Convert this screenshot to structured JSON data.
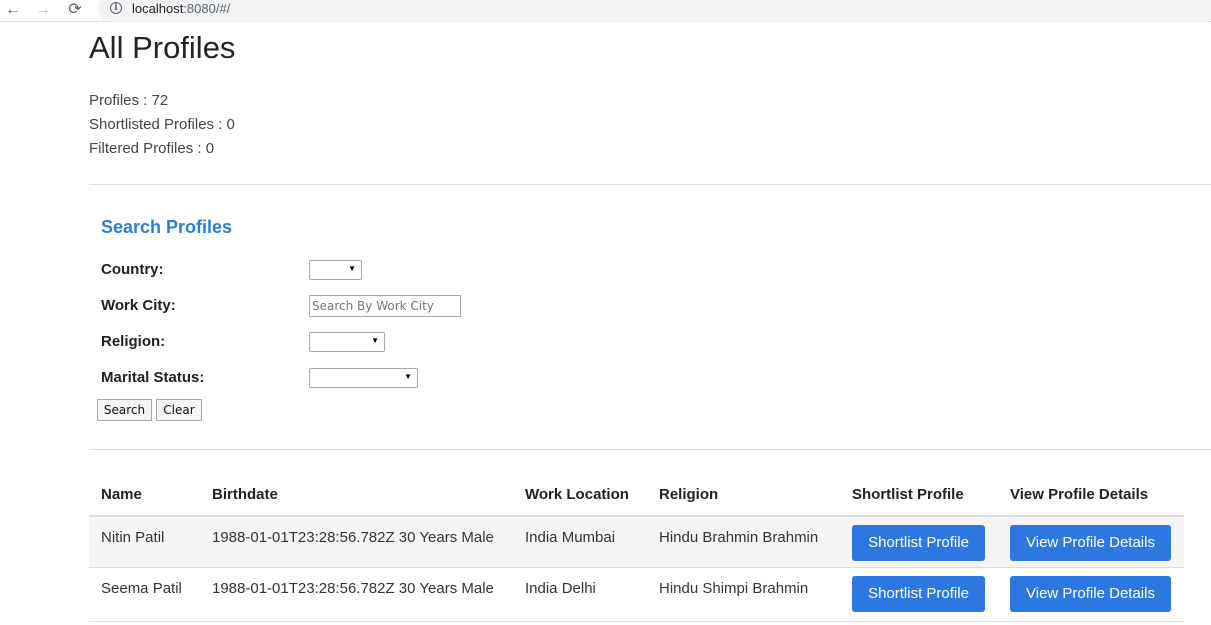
{
  "browser": {
    "url_host": "localhost",
    "url_rest": ":8080/#/",
    "back_icon": "←",
    "forward_icon": "→",
    "reload_icon": "⟳",
    "info_icon": "i"
  },
  "page": {
    "title": "All Profiles",
    "stats": {
      "profiles": "Profiles : 72",
      "shortlisted": "Shortlisted Profiles : 0",
      "filtered": "Filtered Profiles : 0"
    }
  },
  "search": {
    "title": "Search Profiles",
    "country_label": "Country:",
    "work_city_label": "Work City:",
    "work_city_placeholder": "Search By Work City",
    "religion_label": "Religion:",
    "marital_label": "Marital Status:",
    "caret": "▼",
    "search_button": "Search",
    "clear_button": "Clear"
  },
  "table": {
    "headers": {
      "name": "Name",
      "birthdate": "Birthdate",
      "work_location": "Work Location",
      "religion": "Religion",
      "shortlist": "Shortlist Profile",
      "view": "View Profile Details"
    },
    "rows": [
      {
        "name": "Nitin Patil",
        "birthdate": "1988-01-01T23:28:56.782Z 30 Years Male",
        "work_location": "India Mumbai",
        "religion": "Hindu Brahmin Brahmin",
        "shortlist_button": "Shortlist Profile",
        "view_button": "View Profile Details"
      },
      {
        "name": "Seema Patil",
        "birthdate": "1988-01-01T23:28:56.782Z 30 Years Male",
        "work_location": "India Delhi",
        "religion": "Hindu Shimpi Brahmin",
        "shortlist_button": "Shortlist Profile",
        "view_button": "View Profile Details"
      }
    ]
  },
  "colors": {
    "accent": "#2d77e0",
    "link_heading": "#2b7fd8",
    "row_striped": "#f5f5f5",
    "divider": "#dddddd"
  }
}
